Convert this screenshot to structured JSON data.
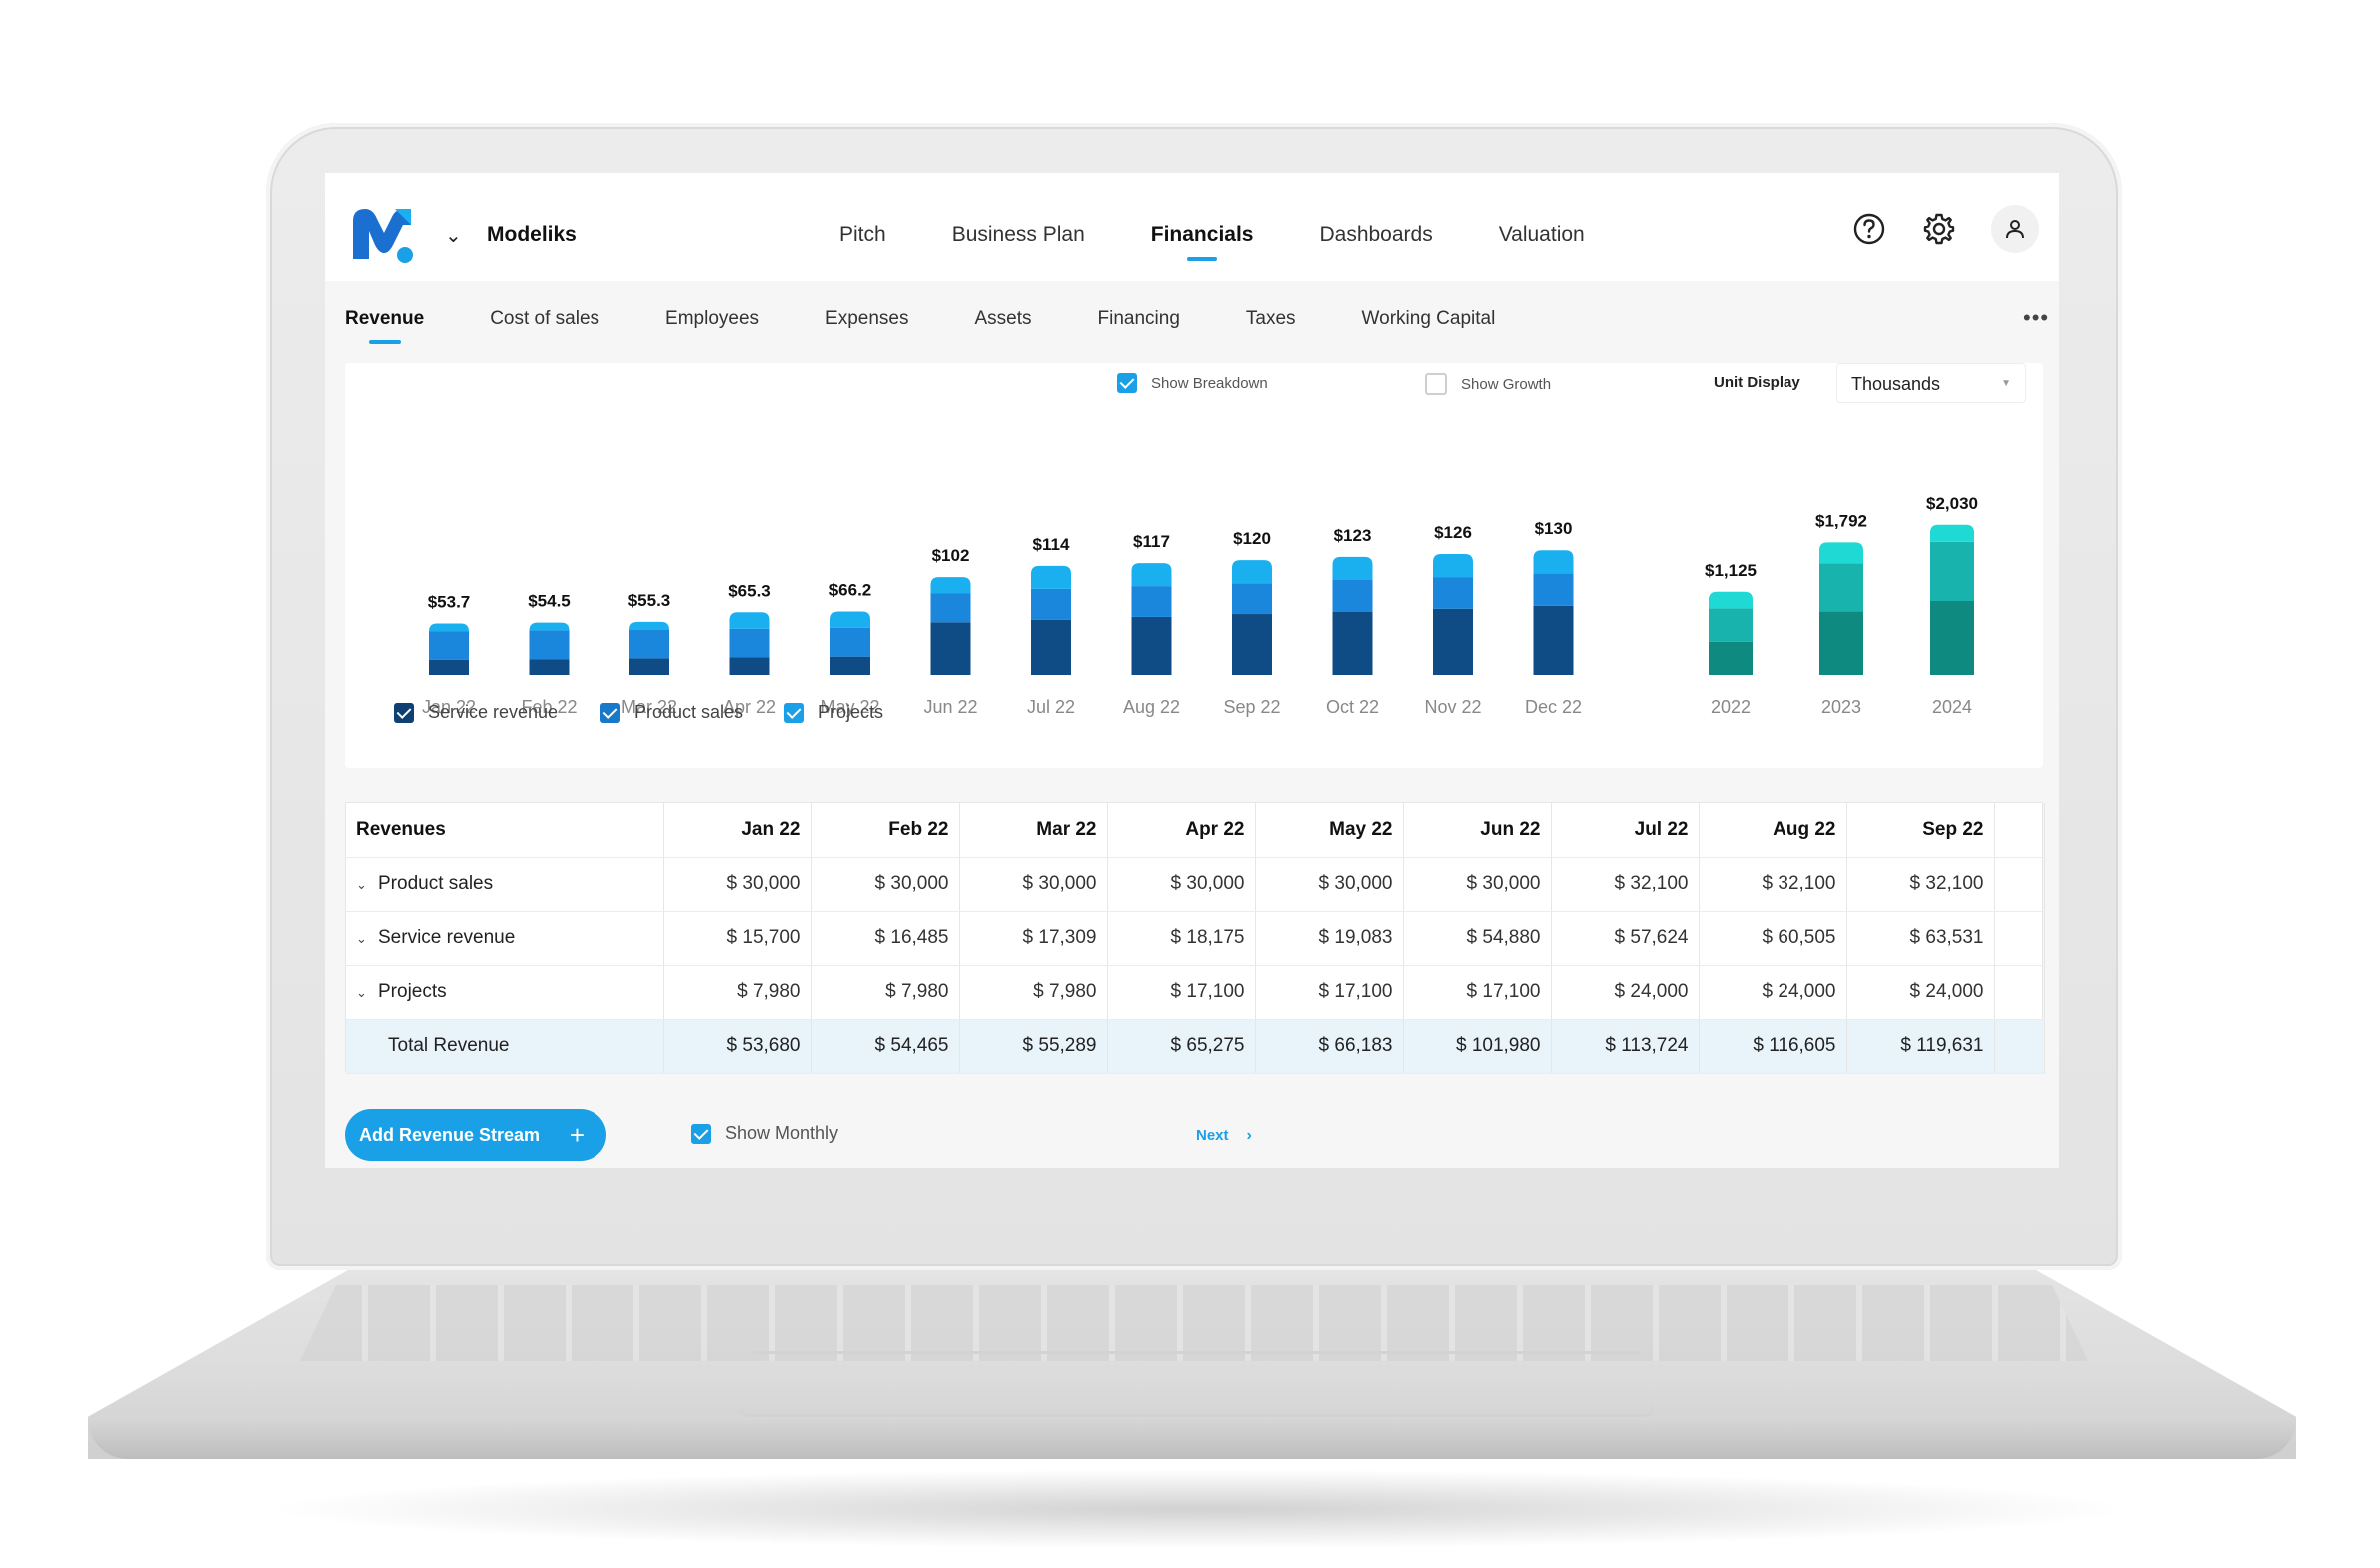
{
  "app": {
    "brand": "Modeliks"
  },
  "main_nav": [
    {
      "label": "Pitch",
      "active": false
    },
    {
      "label": "Business Plan",
      "active": false
    },
    {
      "label": "Financials",
      "active": true
    },
    {
      "label": "Dashboards",
      "active": false
    },
    {
      "label": "Valuation",
      "active": false
    }
  ],
  "header_icons": [
    "help-icon",
    "gear-icon",
    "user-icon"
  ],
  "sub_nav": [
    {
      "label": "Revenue",
      "active": true
    },
    {
      "label": "Cost of sales",
      "active": false
    },
    {
      "label": "Employees",
      "active": false
    },
    {
      "label": "Expenses",
      "active": false
    },
    {
      "label": "Assets",
      "active": false
    },
    {
      "label": "Financing",
      "active": false
    },
    {
      "label": "Taxes",
      "active": false
    },
    {
      "label": "Working Capital",
      "active": false
    }
  ],
  "options": {
    "show_breakdown": {
      "label": "Show Breakdown",
      "checked": true
    },
    "show_growth": {
      "label": "Show Growth",
      "checked": false
    },
    "unit_display_label": "Unit Display",
    "unit_display_value": "Thousands"
  },
  "colors": {
    "accent": "#1aa0e6",
    "service_revenue": "#0f4c86",
    "product_sales": "#1a86dc",
    "projects": "#1ab0f0",
    "annual_bottom": "#0f8a80",
    "annual_middle": "#17b3ac",
    "annual_top": "#1fd9d4"
  },
  "chart_data": [
    {
      "type": "bar",
      "stacked": true,
      "categories": [
        "Jan 22",
        "Feb 22",
        "Mar 22",
        "Apr 22",
        "May 22",
        "Jun 22",
        "Jul 22",
        "Aug 22",
        "Sep 22",
        "Oct 22",
        "Nov 22",
        "Dec 22"
      ],
      "series": [
        {
          "name": "Service revenue",
          "values": [
            15.7,
            16.5,
            17.3,
            18.2,
            19.1,
            54.9,
            57.6,
            60.5,
            63.5,
            66.0,
            69.0,
            72.0
          ]
        },
        {
          "name": "Product sales",
          "values": [
            30.0,
            30.0,
            30.0,
            30.0,
            30.0,
            30.0,
            32.1,
            32.1,
            32.1,
            33.0,
            33.0,
            34.0
          ]
        },
        {
          "name": "Projects",
          "values": [
            8.0,
            8.0,
            8.0,
            17.1,
            17.1,
            17.1,
            24.0,
            24.0,
            24.0,
            24.0,
            24.0,
            24.0
          ]
        }
      ],
      "data_labels": [
        "$53.7",
        "$54.5",
        "$55.3",
        "$65.3",
        "$66.2",
        "$102",
        "$114",
        "$117",
        "$120",
        "$123",
        "$126",
        "$130"
      ],
      "totals": [
        53.7,
        54.5,
        55.3,
        65.3,
        66.2,
        102,
        114,
        117,
        120,
        123,
        126,
        130
      ],
      "legend": [
        "Service revenue",
        "Product sales",
        "Projects"
      ],
      "legend_position": "bottom-left",
      "grid": false
    },
    {
      "type": "bar",
      "stacked": true,
      "categories": [
        "2022",
        "2023",
        "2024"
      ],
      "series": [
        {
          "name": "Service revenue",
          "values": [
            450,
            860,
            1000
          ]
        },
        {
          "name": "Product sales",
          "values": [
            450,
            650,
            800
          ]
        },
        {
          "name": "Projects",
          "values": [
            225,
            282,
            230
          ]
        }
      ],
      "data_labels": [
        "$1,125",
        "$1,792",
        "$2,030"
      ],
      "totals": [
        1125,
        1792,
        2030
      ],
      "grid": false
    }
  ],
  "legend_items": [
    {
      "label": "Service revenue"
    },
    {
      "label": "Product sales"
    },
    {
      "label": "Projects"
    }
  ],
  "table": {
    "header": [
      "Revenues",
      "Jan 22",
      "Feb 22",
      "Mar 22",
      "Apr 22",
      "May 22",
      "Jun 22",
      "Jul 22",
      "Aug 22",
      "Sep 22"
    ],
    "rows": [
      {
        "label": "Product sales",
        "expandable": true,
        "values": [
          "$ 30,000",
          "$ 30,000",
          "$ 30,000",
          "$ 30,000",
          "$ 30,000",
          "$ 30,000",
          "$ 32,100",
          "$ 32,100",
          "$ 32,100"
        ]
      },
      {
        "label": "Service revenue",
        "expandable": true,
        "values": [
          "$ 15,700",
          "$ 16,485",
          "$ 17,309",
          "$ 18,175",
          "$ 19,083",
          "$ 54,880",
          "$ 57,624",
          "$ 60,505",
          "$ 63,531"
        ]
      },
      {
        "label": "Projects",
        "expandable": true,
        "values": [
          "$ 7,980",
          "$ 7,980",
          "$ 7,980",
          "$ 17,100",
          "$ 17,100",
          "$ 17,100",
          "$ 24,000",
          "$ 24,000",
          "$ 24,000"
        ]
      },
      {
        "label": "Total Revenue",
        "expandable": false,
        "total": true,
        "values": [
          "$ 53,680",
          "$ 54,465",
          "$ 55,289",
          "$ 65,275",
          "$ 66,183",
          "$ 101,980",
          "$ 113,724",
          "$ 116,605",
          "$ 119,631"
        ]
      }
    ]
  },
  "footer": {
    "add_button": "Add Revenue Stream",
    "show_monthly": {
      "label": "Show Monthly",
      "checked": true
    },
    "next_label": "Next"
  }
}
